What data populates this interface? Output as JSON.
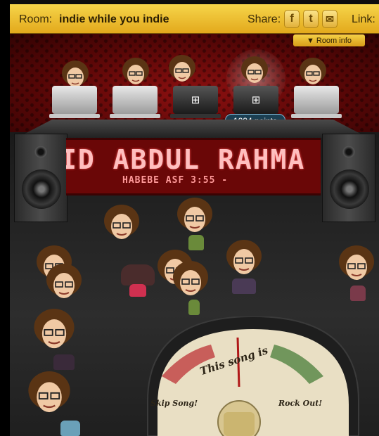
{
  "header": {
    "room_label": "Room:",
    "room_name": "indie while you indie",
    "share_label": "Share:",
    "share_buttons": [
      {
        "icon": "facebook-icon",
        "glyph": "f"
      },
      {
        "icon": "twitter-icon",
        "glyph": "t"
      },
      {
        "icon": "email-icon",
        "glyph": "✉"
      }
    ],
    "link_label": "Link:",
    "room_info_label": "Room info"
  },
  "stage": {
    "now_playing_title": "ID ABDUL RAHMA",
    "now_playing_subtitle": "HABEBE ASF 3:55 -",
    "dj_points": "1094 points",
    "laptops": [
      "apple-laptop",
      "apple-laptop",
      "windows-laptop",
      "windows-laptop",
      "apple-laptop"
    ]
  },
  "meter": {
    "label": "This song is",
    "skip_label": "Skip Song!",
    "rock_label": "Rock Out!"
  },
  "colors": {
    "header_gold": "#f2c33a",
    "stage_red": "#7a0a0a",
    "points_badge": "#1b3f52"
  }
}
